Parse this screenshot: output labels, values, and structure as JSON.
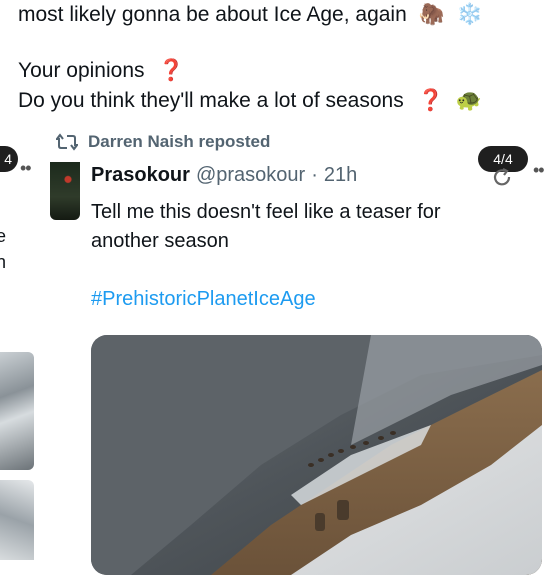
{
  "post": {
    "line1": "most likely gonna be about Ice Age, again",
    "line1_emojis": [
      "🦣",
      "❄️"
    ],
    "line2": "Your opinions",
    "line2_emoji": "❓",
    "line3": "Do you think they'll make a lot of seasons",
    "line3_emojis": [
      "❓",
      "🐢"
    ]
  },
  "left_card": {
    "badge_fragment": "4",
    "dots": "••",
    "text_fragments": [
      "e",
      "n"
    ]
  },
  "repost": {
    "reposted_by": "Darren Naish reposted",
    "display_name": "Prasokour",
    "handle": "@prasokour",
    "separator": "·",
    "time": "21h",
    "text_line1": "Tell me this doesn't feel like a teaser for",
    "text_line2": "another season",
    "hashtag": "#PrehistoricPlanetIceAge",
    "page_indicator": "4/4",
    "more_dots": "••"
  },
  "colors": {
    "text": "#0f1419",
    "secondary": "#536471",
    "link": "#1d9bf0",
    "badge_bg": "#1f1f1f",
    "question": "#e0191b"
  },
  "icons": {
    "repost": "repost-icon",
    "refresh": "refresh-icon",
    "more": "more-icon"
  }
}
